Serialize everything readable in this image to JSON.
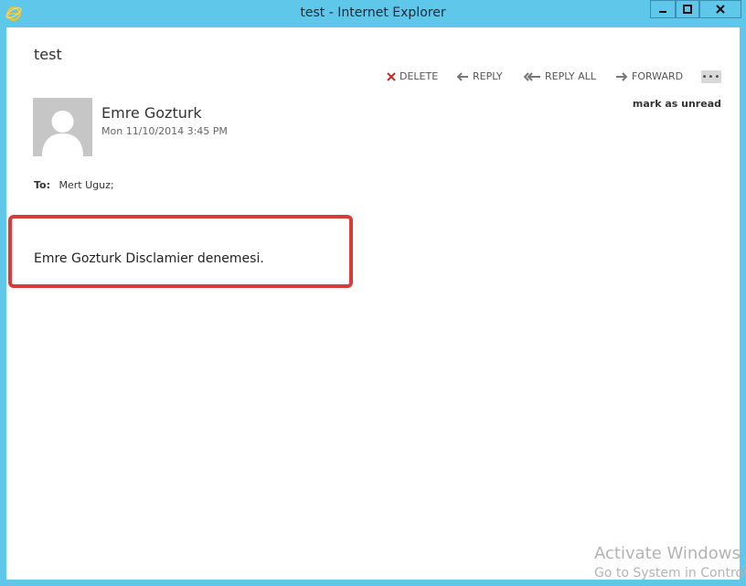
{
  "window": {
    "title": "test - Internet Explorer",
    "controls": {
      "minimize": "minimize-icon",
      "maximize": "maximize-icon",
      "close": "close-icon"
    }
  },
  "message": {
    "subject": "test",
    "actions": {
      "delete": "DELETE",
      "reply": "REPLY",
      "reply_all": "REPLY ALL",
      "forward": "FORWARD",
      "more": "•••"
    },
    "mark_unread": "mark as unread",
    "sender": "Emre Gozturk",
    "date": "Mon 11/10/2014 3:45 PM",
    "to_label": "To:",
    "to_value": "Mert Uguz;",
    "body": "Emre Gozturk Disclamier denemesi."
  },
  "watermark": {
    "title": "Activate Windows",
    "subtitle": "Go to System in Control"
  },
  "colors": {
    "frame": "#5ec7ea",
    "highlight": "#d93a3a",
    "delete_x": "#c62828"
  }
}
